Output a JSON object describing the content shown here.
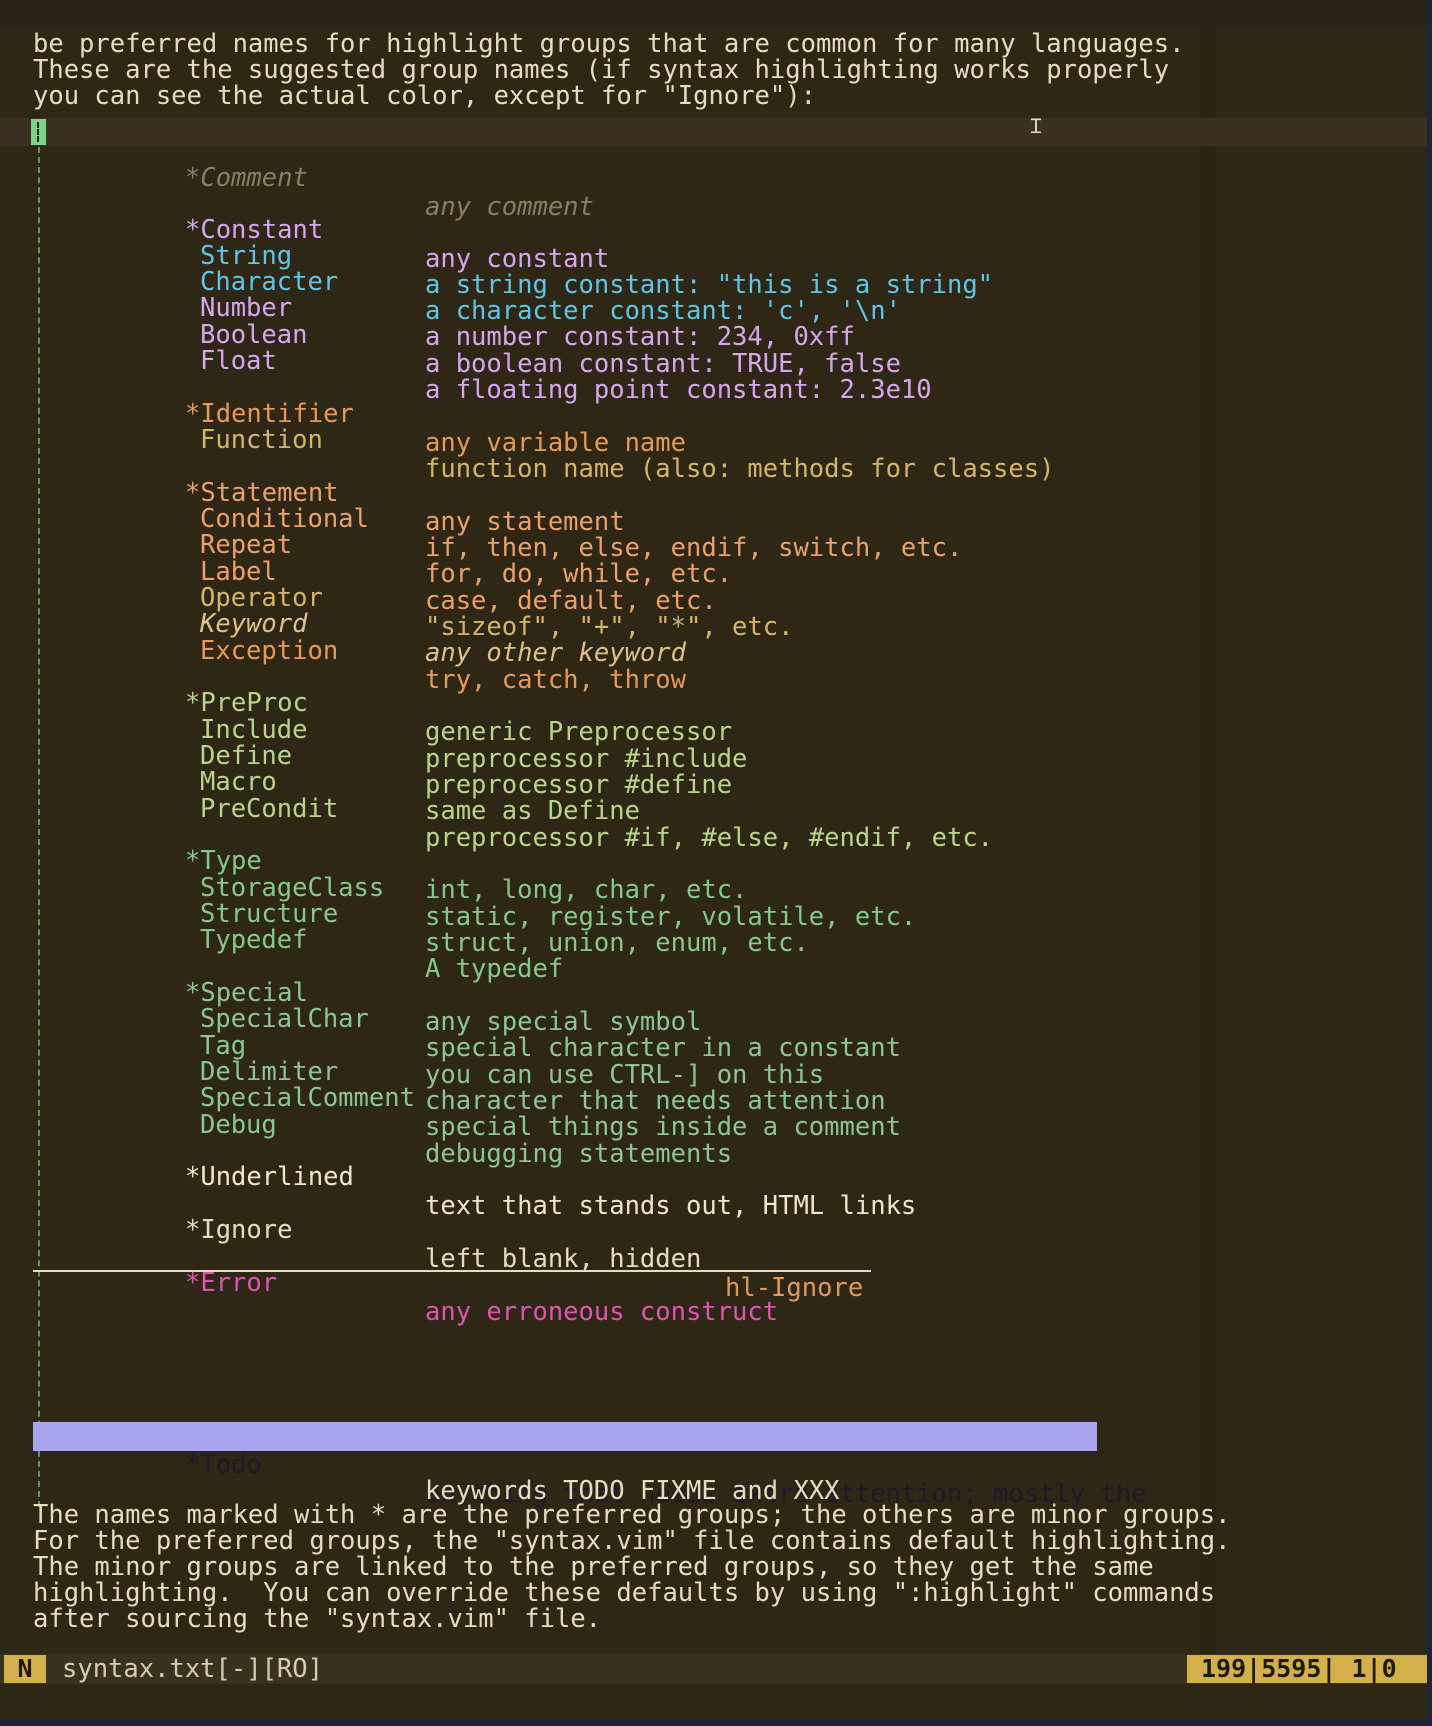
{
  "editor": {
    "intro_lines": [
      "be preferred names for highlight groups that are common for many languages.",
      "These are the suggested group names (if syntax highlighting works properly",
      "you can see the actual color, except for \"Ignore\"):"
    ],
    "groups": {
      "comment": {
        "name": "*Comment",
        "desc": "any comment"
      },
      "constant": {
        "name": "*Constant",
        "desc": "any constant"
      },
      "string": {
        "name": "String",
        "desc": "a string constant: \"this is a string\""
      },
      "character": {
        "name": "Character",
        "desc": "a character constant: 'c', '\\n'"
      },
      "number": {
        "name": "Number",
        "desc": "a number constant: 234, 0xff"
      },
      "boolean": {
        "name": "Boolean",
        "desc": "a boolean constant: TRUE, false"
      },
      "float": {
        "name": "Float",
        "desc": "a floating point constant: 2.3e10"
      },
      "identifier": {
        "name": "*Identifier",
        "desc": "any variable name"
      },
      "function": {
        "name": "Function",
        "desc": "function name (also: methods for classes)"
      },
      "statement": {
        "name": "*Statement",
        "desc": "any statement"
      },
      "conditional": {
        "name": "Conditional",
        "desc": "if, then, else, endif, switch, etc."
      },
      "repeat": {
        "name": "Repeat",
        "desc": "for, do, while, etc."
      },
      "label": {
        "name": "Label",
        "desc": "case, default, etc."
      },
      "operator": {
        "name": "Operator",
        "desc": "\"sizeof\", \"+\", \"*\", etc."
      },
      "keyword": {
        "name": "Keyword",
        "desc": "any other keyword"
      },
      "exception": {
        "name": "Exception",
        "desc": "try, catch, throw"
      },
      "preproc": {
        "name": "*PreProc",
        "desc": "generic Preprocessor"
      },
      "include": {
        "name": "Include",
        "desc": "preprocessor #include"
      },
      "define": {
        "name": "Define",
        "desc": "preprocessor #define"
      },
      "macro": {
        "name": "Macro",
        "desc": "same as Define"
      },
      "precondit": {
        "name": "PreCondit",
        "desc": "preprocessor #if, #else, #endif, etc."
      },
      "type": {
        "name": "*Type",
        "desc": "int, long, char, etc."
      },
      "storageclass": {
        "name": "StorageClass",
        "desc": "static, register, volatile, etc."
      },
      "structure": {
        "name": "Structure",
        "desc": "struct, union, enum, etc."
      },
      "typedef": {
        "name": "Typedef",
        "desc": "A typedef"
      },
      "special": {
        "name": "*Special",
        "desc": "any special symbol"
      },
      "specialchar": {
        "name": "SpecialChar",
        "desc": "special character in a constant"
      },
      "tag": {
        "name": "Tag",
        "desc": "you can use CTRL-] on this"
      },
      "delimiter": {
        "name": "Delimiter",
        "desc": "character that needs attention"
      },
      "specialcomment": {
        "name": "SpecialComment",
        "desc": "special things inside a comment"
      },
      "debug": {
        "name": "Debug",
        "desc": "debugging statements"
      },
      "underlined": {
        "name": "*Underlined",
        "desc": "text that stands out, HTML links"
      },
      "ignore": {
        "name": "*Ignore",
        "desc": "left blank, hidden",
        "tag": "hl-Ignore"
      },
      "error": {
        "name": "*Error",
        "desc": "any erroneous construct"
      },
      "todo": {
        "name": "*Todo",
        "desc": "anything that needs extra attention; mostly the",
        "desc2": "keywords TODO FIXME and XXX"
      }
    },
    "outro_lines": [
      "The names marked with * are the preferred groups; the others are minor groups.",
      "For the preferred groups, the \"syntax.vim\" file contains default highlighting.",
      "The minor groups are linked to the preferred groups, so they get the same",
      "highlighting.  You can override these defaults by using \":highlight\" commands",
      "after sourcing the \"syntax.vim\" file."
    ]
  },
  "statusline": {
    "mode": "N",
    "filename": "syntax.txt[-][RO]",
    "position": "199|5595| 1|0"
  },
  "colors": {
    "background": "#2f2716",
    "mode_badge": "#d4b04a",
    "todo_highlight": "#a9a4ee",
    "cursor": "#7bd48a"
  }
}
